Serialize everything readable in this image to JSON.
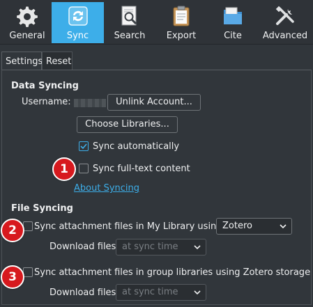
{
  "toolbar": {
    "items": [
      {
        "label": "General",
        "icon": "gear-icon"
      },
      {
        "label": "Sync",
        "icon": "sync-icon",
        "active": true
      },
      {
        "label": "Search",
        "icon": "search-icon"
      },
      {
        "label": "Export",
        "icon": "clipboard-icon"
      },
      {
        "label": "Cite",
        "icon": "folder-icon"
      },
      {
        "label": "Advanced",
        "icon": "tools-icon"
      }
    ]
  },
  "tabs": [
    "Settings",
    "Reset"
  ],
  "data_syncing": {
    "heading": "Data Syncing",
    "username_label": "Username:",
    "unlink_label": "Unlink Account...",
    "choose_libraries_label": "Choose Libraries...",
    "sync_auto_label": "Sync automatically",
    "sync_auto_checked": true,
    "sync_fulltext_label": "Sync full-text content",
    "sync_fulltext_checked": false,
    "about_link": "About Syncing"
  },
  "file_syncing": {
    "heading": "File Syncing",
    "my_library_label": "Sync attachment files in My Library using",
    "my_library_checked": false,
    "storage_value": "Zotero",
    "download_label_1": "Download files",
    "download_value_1": "at sync time",
    "group_label": "Sync attachment files in group libraries using Zotero storage",
    "group_checked": false,
    "download_label_2": "Download files",
    "download_value_2": "at sync time"
  },
  "badges": [
    "1",
    "2",
    "3"
  ],
  "colors": {
    "accent": "#3daee9",
    "background": "#31363b",
    "badge": "#d7191e"
  }
}
